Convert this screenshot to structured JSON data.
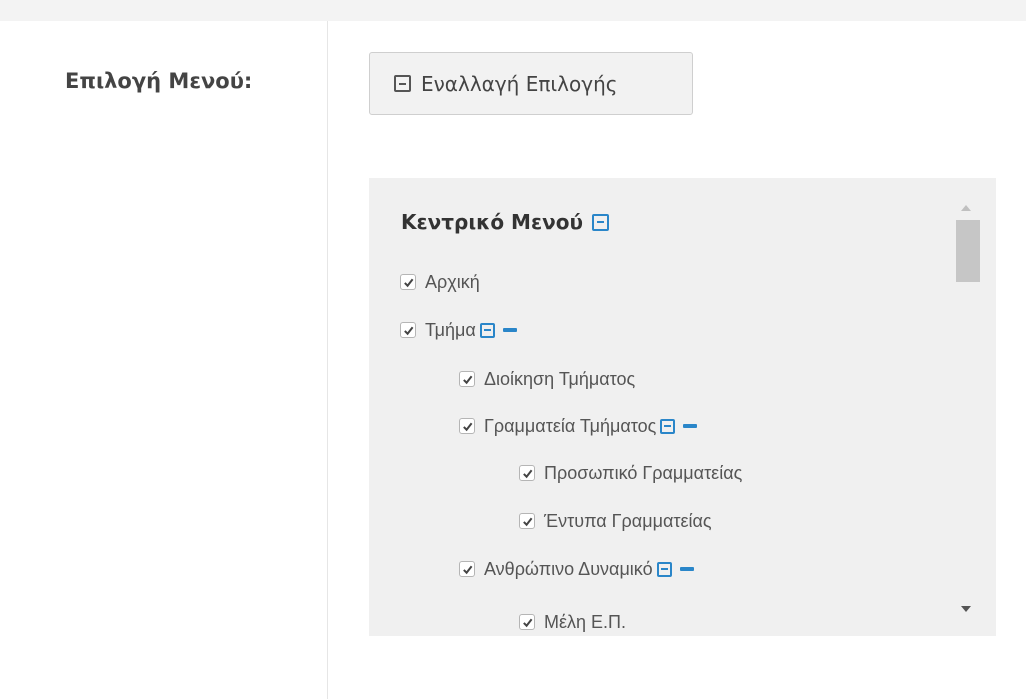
{
  "form": {
    "label": "Επιλογή Μενού:",
    "toggle_button": {
      "label": "Εναλλαγή Επιλογής",
      "icon": "square-minus-icon"
    }
  },
  "tree": {
    "title": "Κεντρικό Μενού",
    "items": [
      {
        "label": "Αρχική",
        "checked": true,
        "level": 0
      },
      {
        "label": "Τμήμα",
        "checked": true,
        "level": 0
      },
      {
        "label": "Διοίκηση Τμήματος",
        "checked": true,
        "level": 1
      },
      {
        "label": "Γραμματεία Τμήματος",
        "checked": true,
        "level": 1
      },
      {
        "label": "Προσωπικό Γραμματείας",
        "checked": true,
        "level": 2
      },
      {
        "label": "Έντυπα Γραμματείας",
        "checked": true,
        "level": 2
      },
      {
        "label": "Ανθρώπινο Δυναμικό",
        "checked": true,
        "level": 1
      },
      {
        "label": "Μέλη Ε.Π.",
        "checked": true,
        "level": 2
      }
    ]
  },
  "colors": {
    "accent": "#2a86c9",
    "panel_bg": "#f0f0f0",
    "button_bg": "#f2f2f2",
    "label_text": "#444444"
  }
}
